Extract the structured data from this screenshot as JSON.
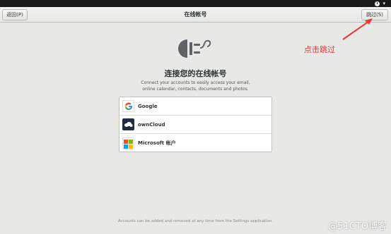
{
  "header": {
    "back_label": "返回(P)",
    "title": "在线帐号",
    "skip_label": "跳过(S)"
  },
  "main": {
    "title": "连接您的在线帐号",
    "subtitle_line1": "Connect your accounts to easily access your email,",
    "subtitle_line2": "online calendar, contacts, documents and photos."
  },
  "providers": [
    {
      "label": "Google",
      "icon": "google-icon"
    },
    {
      "label": "ownCloud",
      "icon": "owncloud-icon"
    },
    {
      "label": "Microsoft 帐户",
      "icon": "microsoft-icon"
    }
  ],
  "footer": {
    "text": "Accounts can be added and removed at any time from the Settings application."
  },
  "annotation": {
    "text": "点击跳过",
    "color": "#e53935"
  },
  "watermark": "@51CTO博客",
  "colors": {
    "background": "#e8e8e7",
    "topbar": "#1a1a1a",
    "annotation": "#e53935"
  }
}
